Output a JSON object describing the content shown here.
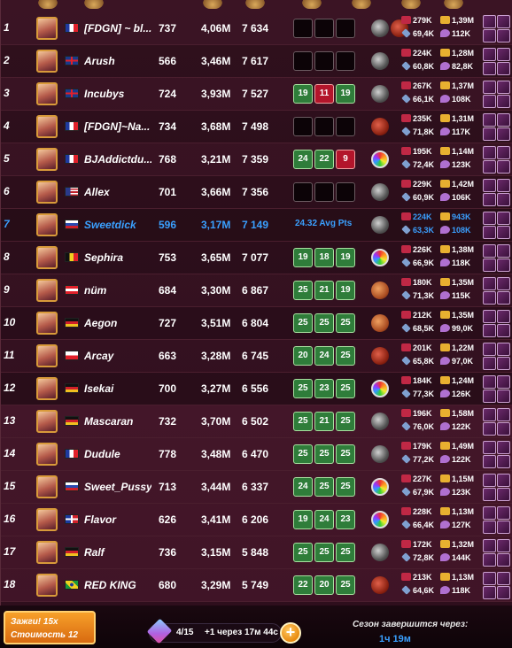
{
  "rows": [
    {
      "rank": "1",
      "name": "[FDGN] ~ bl...",
      "flag": "fr",
      "level": "737",
      "power": "4,06M",
      "points": "7 634",
      "results": [
        null,
        null,
        null
      ],
      "avg": "",
      "icons": [
        "grey",
        "red"
      ],
      "h": "279K",
      "c": "1,39M",
      "d": "69,4K",
      "p": "112K"
    },
    {
      "rank": "2",
      "name": "Arush",
      "flag": "gb",
      "level": "566",
      "power": "3,46M",
      "points": "7 617",
      "results": [
        null,
        null,
        null
      ],
      "avg": "",
      "icons": [
        "grey"
      ],
      "h": "224K",
      "c": "1,28M",
      "d": "60,8K",
      "p": "82,8K"
    },
    {
      "rank": "3",
      "name": "Incubys",
      "flag": "gb",
      "level": "724",
      "power": "3,93M",
      "points": "7 527",
      "results": [
        "19",
        "11",
        "19"
      ],
      "avg": "",
      "icons": [
        "grey"
      ],
      "h": "267K",
      "c": "1,37M",
      "d": "66,1K",
      "p": "108K"
    },
    {
      "rank": "4",
      "name": "[FDGN]~Na...",
      "flag": "fr",
      "level": "734",
      "power": "3,68M",
      "points": "7 498",
      "results": [
        null,
        null,
        null
      ],
      "avg": "",
      "icons": [
        "red"
      ],
      "h": "235K",
      "c": "1,31M",
      "d": "71,8K",
      "p": "117K"
    },
    {
      "rank": "5",
      "name": "BJAddictdu...",
      "flag": "fr",
      "level": "768",
      "power": "3,21M",
      "points": "7 359",
      "results": [
        "24",
        "22",
        "9"
      ],
      "avg": "",
      "icons": [
        "rainbow"
      ],
      "h": "195K",
      "c": "1,14M",
      "d": "72,4K",
      "p": "123K"
    },
    {
      "rank": "6",
      "name": "Allex",
      "flag": "us",
      "level": "701",
      "power": "3,66M",
      "points": "7 356",
      "results": [
        null,
        null,
        null
      ],
      "avg": "",
      "icons": [
        "grey"
      ],
      "h": "229K",
      "c": "1,42M",
      "d": "60,9K",
      "p": "106K"
    },
    {
      "rank": "7",
      "name": "Sweetdick",
      "flag": "ru",
      "level": "596",
      "power": "3,17M",
      "points": "7 149",
      "results": [],
      "avg": "24.32 Avg Pts",
      "icons": [
        "grey"
      ],
      "h": "224K",
      "c": "943K",
      "d": "63,3K",
      "p": "108K"
    },
    {
      "rank": "8",
      "name": "Sephira",
      "flag": "be",
      "level": "753",
      "power": "3,65M",
      "points": "7 077",
      "results": [
        "19",
        "18",
        "19"
      ],
      "avg": "",
      "icons": [
        "rainbow"
      ],
      "h": "226K",
      "c": "1,38M",
      "d": "66,9K",
      "p": "118K"
    },
    {
      "rank": "9",
      "name": "nüm",
      "flag": "at",
      "level": "684",
      "power": "3,30M",
      "points": "6 867",
      "results": [
        "25",
        "21",
        "19"
      ],
      "avg": "",
      "icons": [
        "orange"
      ],
      "h": "180K",
      "c": "1,35M",
      "d": "71,3K",
      "p": "115K"
    },
    {
      "rank": "10",
      "name": "Aegon",
      "flag": "de",
      "level": "727",
      "power": "3,51M",
      "points": "6 804",
      "results": [
        "25",
        "25",
        "25"
      ],
      "avg": "",
      "icons": [
        "orange"
      ],
      "h": "212K",
      "c": "1,35M",
      "d": "68,5K",
      "p": "99,0K"
    },
    {
      "rank": "11",
      "name": "Arcay",
      "flag": "pl",
      "level": "663",
      "power": "3,28M",
      "points": "6 745",
      "results": [
        "20",
        "24",
        "25"
      ],
      "avg": "",
      "icons": [
        "red"
      ],
      "h": "201K",
      "c": "1,22M",
      "d": "65,8K",
      "p": "97,0K"
    },
    {
      "rank": "12",
      "name": "Isekai",
      "flag": "de",
      "level": "700",
      "power": "3,27M",
      "points": "6 556",
      "results": [
        "25",
        "23",
        "25"
      ],
      "avg": "",
      "icons": [
        "rainbow"
      ],
      "h": "184K",
      "c": "1,24M",
      "d": "77,3K",
      "p": "126K"
    },
    {
      "rank": "13",
      "name": "Mascaran",
      "flag": "de",
      "level": "732",
      "power": "3,70M",
      "points": "6 502",
      "results": [
        "25",
        "21",
        "25"
      ],
      "avg": "",
      "icons": [
        "grey"
      ],
      "h": "196K",
      "c": "1,58M",
      "d": "76,0K",
      "p": "122K"
    },
    {
      "rank": "14",
      "name": "Dudule",
      "flag": "fr",
      "level": "778",
      "power": "3,48M",
      "points": "6 470",
      "results": [
        "25",
        "25",
        "25"
      ],
      "avg": "",
      "icons": [
        "grey"
      ],
      "h": "179K",
      "c": "1,49M",
      "d": "77,2K",
      "p": "122K"
    },
    {
      "rank": "15",
      "name": "Sweet_Pussy",
      "flag": "ru",
      "level": "713",
      "power": "3,44M",
      "points": "6 337",
      "results": [
        "24",
        "25",
        "25"
      ],
      "avg": "",
      "icons": [
        "rainbow"
      ],
      "h": "227K",
      "c": "1,15M",
      "d": "67,9K",
      "p": "123K"
    },
    {
      "rank": "16",
      "name": "Flavor",
      "flag": "do",
      "level": "626",
      "power": "3,41M",
      "points": "6 206",
      "results": [
        "19",
        "24",
        "23"
      ],
      "avg": "",
      "icons": [
        "rainbow"
      ],
      "h": "228K",
      "c": "1,13M",
      "d": "66,4K",
      "p": "127K"
    },
    {
      "rank": "17",
      "name": "Ralf",
      "flag": "de",
      "level": "736",
      "power": "3,15M",
      "points": "5 848",
      "results": [
        "25",
        "25",
        "25"
      ],
      "avg": "",
      "icons": [
        "grey"
      ],
      "h": "172K",
      "c": "1,32M",
      "d": "72,8K",
      "p": "144K"
    },
    {
      "rank": "18",
      "name": "RED KING",
      "flag": "br",
      "level": "680",
      "power": "3,29M",
      "points": "5 749",
      "results": [
        "22",
        "20",
        "25"
      ],
      "avg": "",
      "icons": [
        "red"
      ],
      "h": "213K",
      "c": "1,13M",
      "d": "64,6K",
      "p": "118K"
    }
  ],
  "footer": {
    "combat_line1": "Зажги! 15x",
    "combat_line2": "Стоимость 12",
    "energy_value": "4/15",
    "energy_refill": "+1 через 17м 44с",
    "plus_label": "+",
    "season_label": "Сезон завершится через:",
    "season_time": "1ч 19м"
  },
  "colors": {
    "accent": "#3aa0ff",
    "win": "#2f7d3a",
    "loss": "#b3152b",
    "orange": "#f7a02a"
  }
}
